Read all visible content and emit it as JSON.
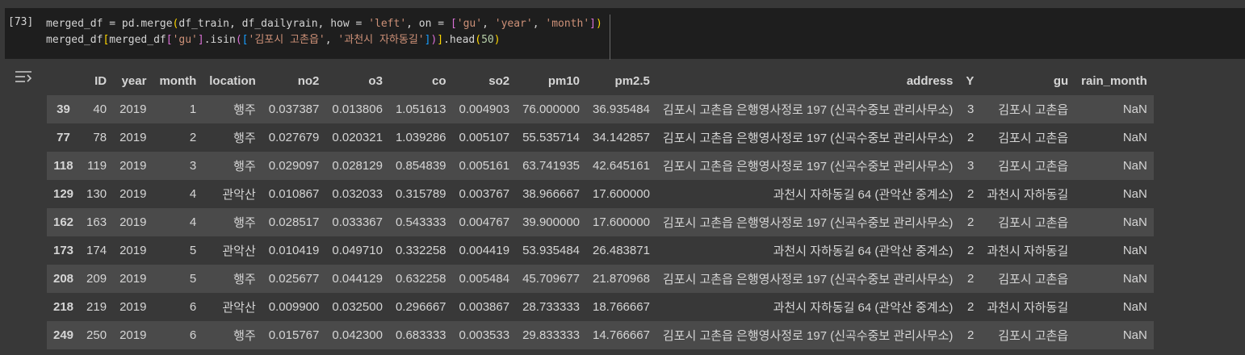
{
  "cell": {
    "exec_count": "[73]",
    "line1": {
      "a": "merged_df = pd.merge",
      "p1": "(",
      "b": "df_train, df_dailyrain, how = ",
      "s1": "'left'",
      "c": ", on = ",
      "p2": "[",
      "s2": "'gu'",
      "d": ", ",
      "s3": "'year'",
      "e": ", ",
      "s4": "'month'",
      "p3": "]",
      "p4": ")"
    },
    "line2": {
      "a": "merged_df",
      "p1": "[",
      "b": "merged_df",
      "p2": "[",
      "s1": "'gu'",
      "p3": "]",
      "c": ".isin",
      "p4": "(",
      "p5": "[",
      "s2": "'김포시 고촌읍'",
      "d": ", ",
      "s3": "'과천시 자하동길'",
      "p6": "]",
      "p7": ")",
      "p8": "]",
      "e": ".head",
      "p9": "(",
      "n1": "50",
      "p10": ")"
    }
  },
  "output": {
    "toggle_icon": "output-toggle-icon",
    "columns": [
      "",
      "ID",
      "year",
      "month",
      "location",
      "no2",
      "o3",
      "co",
      "so2",
      "pm10",
      "pm2.5",
      "address",
      "Y",
      "gu",
      "rain_month"
    ],
    "rows": [
      [
        "39",
        "40",
        "2019",
        "1",
        "행주",
        "0.037387",
        "0.013806",
        "1.051613",
        "0.004903",
        "76.000000",
        "36.935484",
        "김포시 고촌읍 은행영사정로 197 (신곡수중보 관리사무소)",
        "3",
        "김포시 고촌읍",
        "NaN"
      ],
      [
        "77",
        "78",
        "2019",
        "2",
        "행주",
        "0.027679",
        "0.020321",
        "1.039286",
        "0.005107",
        "55.535714",
        "34.142857",
        "김포시 고촌읍 은행영사정로 197 (신곡수중보 관리사무소)",
        "2",
        "김포시 고촌읍",
        "NaN"
      ],
      [
        "118",
        "119",
        "2019",
        "3",
        "행주",
        "0.029097",
        "0.028129",
        "0.854839",
        "0.005161",
        "63.741935",
        "42.645161",
        "김포시 고촌읍 은행영사정로 197 (신곡수중보 관리사무소)",
        "3",
        "김포시 고촌읍",
        "NaN"
      ],
      [
        "129",
        "130",
        "2019",
        "4",
        "관악산",
        "0.010867",
        "0.032033",
        "0.315789",
        "0.003767",
        "38.966667",
        "17.600000",
        "과천시 자하동길 64 (관악산 중계소)",
        "2",
        "과천시 자하동길",
        "NaN"
      ],
      [
        "162",
        "163",
        "2019",
        "4",
        "행주",
        "0.028517",
        "0.033367",
        "0.543333",
        "0.004767",
        "39.900000",
        "17.600000",
        "김포시 고촌읍 은행영사정로 197 (신곡수중보 관리사무소)",
        "2",
        "김포시 고촌읍",
        "NaN"
      ],
      [
        "173",
        "174",
        "2019",
        "5",
        "관악산",
        "0.010419",
        "0.049710",
        "0.332258",
        "0.004419",
        "53.935484",
        "26.483871",
        "과천시 자하동길 64 (관악산 중계소)",
        "2",
        "과천시 자하동길",
        "NaN"
      ],
      [
        "208",
        "209",
        "2019",
        "5",
        "행주",
        "0.025677",
        "0.044129",
        "0.632258",
        "0.005484",
        "45.709677",
        "21.870968",
        "김포시 고촌읍 은행영사정로 197 (신곡수중보 관리사무소)",
        "2",
        "김포시 고촌읍",
        "NaN"
      ],
      [
        "218",
        "219",
        "2019",
        "6",
        "관악산",
        "0.009900",
        "0.032500",
        "0.296667",
        "0.003867",
        "28.733333",
        "18.766667",
        "과천시 자하동길 64 (관악산 중계소)",
        "2",
        "과천시 자하동길",
        "NaN"
      ],
      [
        "249",
        "250",
        "2019",
        "6",
        "행주",
        "0.015767",
        "0.042300",
        "0.683333",
        "0.003533",
        "29.833333",
        "14.766667",
        "김포시 고촌읍 은행영사정로 197 (신곡수중보 관리사무소)",
        "2",
        "김포시 고촌읍",
        "NaN"
      ]
    ]
  }
}
